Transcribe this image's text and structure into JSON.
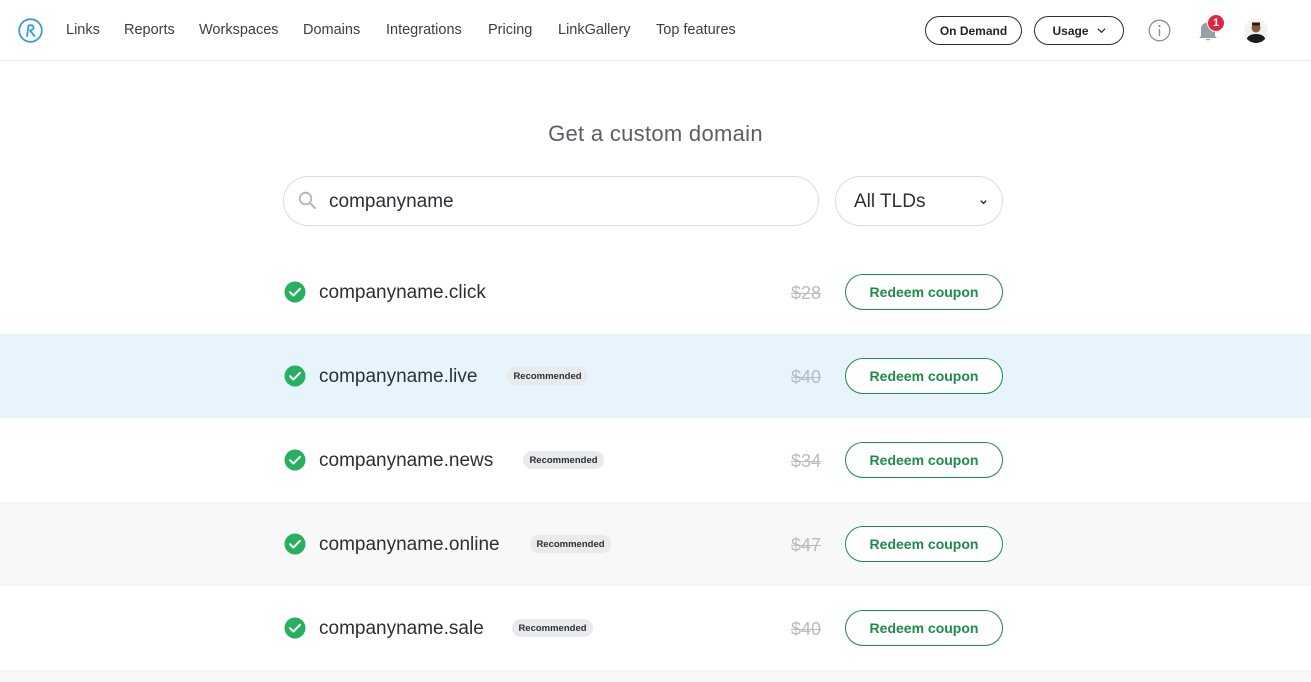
{
  "app": {
    "logo_icon": "rebrandly-logo-icon",
    "brand_color": "#3a9bd9"
  },
  "nav": {
    "items": [
      {
        "label": "Links"
      },
      {
        "label": "Reports"
      },
      {
        "label": "Workspaces"
      },
      {
        "label": "Domains"
      },
      {
        "label": "Integrations"
      },
      {
        "label": "Pricing"
      },
      {
        "label": "LinkGallery"
      },
      {
        "label": "Top features"
      }
    ]
  },
  "header": {
    "on_demand_label": "On Demand",
    "usage_label": "Usage",
    "notification_count": "1",
    "badge_color": "#e0263f"
  },
  "main": {
    "title": "Get a custom domain",
    "search": {
      "value": "companyname",
      "placeholder": ""
    },
    "tld_filter": {
      "selected": "All TLDs"
    },
    "accent_color": "#1e8a4c",
    "results": [
      {
        "domain": "companyname.click",
        "recommended": false,
        "badge": "",
        "price": "$28",
        "action": "Redeem coupon"
      },
      {
        "domain": "companyname.live",
        "recommended": true,
        "badge": "Recommended",
        "price": "$40",
        "action": "Redeem coupon"
      },
      {
        "domain": "companyname.news",
        "recommended": true,
        "badge": "Recommended",
        "price": "$34",
        "action": "Redeem coupon"
      },
      {
        "domain": "companyname.online",
        "recommended": true,
        "badge": "Recommended",
        "price": "$47",
        "action": "Redeem coupon"
      },
      {
        "domain": "companyname.sale",
        "recommended": true,
        "badge": "Recommended",
        "price": "$40",
        "action": "Redeem coupon"
      }
    ]
  }
}
